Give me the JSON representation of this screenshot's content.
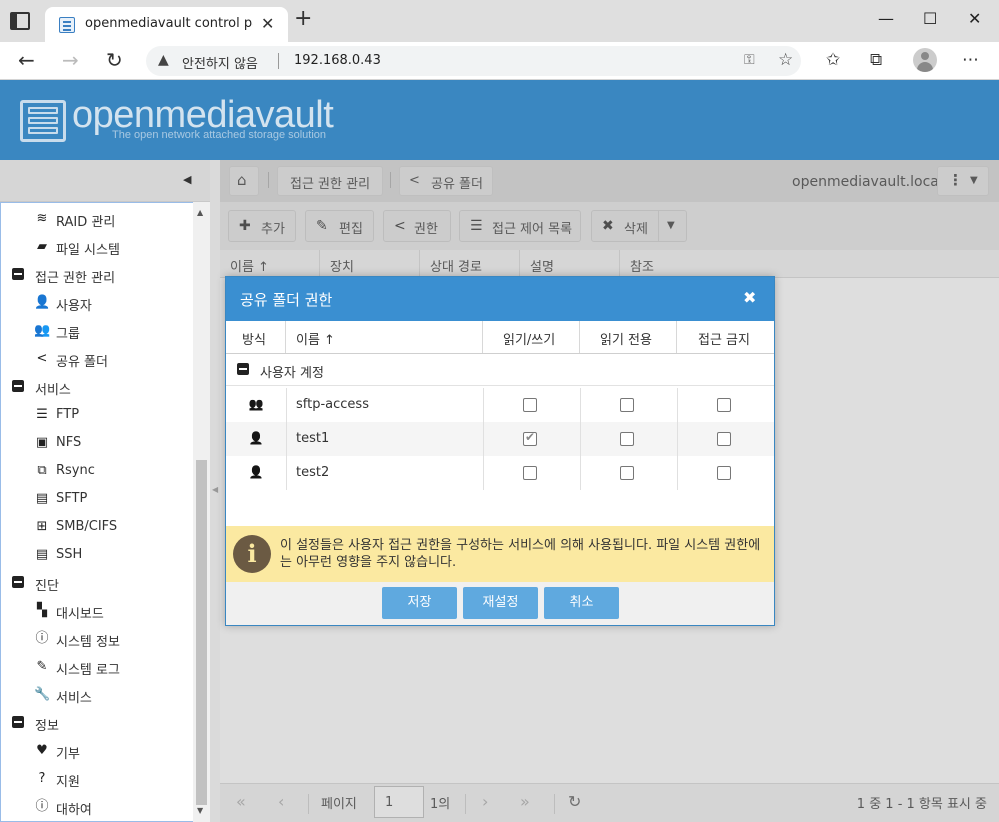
{
  "browser": {
    "tab_title": "openmediavault control panel - c",
    "tab_close": "✕",
    "new_tab": "+",
    "url_insecure": "안전하지 않음",
    "url": "192.168.0.43"
  },
  "omv": {
    "logo_name": "openmediavault",
    "logo_tagline": "The open network attached storage solution",
    "host": "openmediavault.local"
  },
  "nav": {
    "items": [
      {
        "label": "RAID 관리",
        "icon": "raid-icon",
        "glyph": "≋",
        "level": "item"
      },
      {
        "label": "파일 시스템",
        "icon": "folder-icon",
        "glyph": "▰",
        "level": "item"
      },
      {
        "label": "접근 권한 관리",
        "icon": "minus-box-icon",
        "glyph": "",
        "level": "group"
      },
      {
        "label": "사용자",
        "icon": "user-icon",
        "glyph": "👤",
        "level": "item"
      },
      {
        "label": "그룹",
        "icon": "users-icon",
        "glyph": "👥",
        "level": "item"
      },
      {
        "label": "공유 폴더",
        "icon": "share-icon",
        "glyph": "<",
        "level": "item"
      },
      {
        "label": "서비스",
        "icon": "minus-box-icon",
        "glyph": "",
        "level": "group"
      },
      {
        "label": "FTP",
        "icon": "ftp-icon",
        "glyph": "☰",
        "level": "item"
      },
      {
        "label": "NFS",
        "icon": "nfs-icon",
        "glyph": "▣",
        "level": "item"
      },
      {
        "label": "Rsync",
        "icon": "rsync-icon",
        "glyph": "⧉",
        "level": "item"
      },
      {
        "label": "SFTP",
        "icon": "terminal-icon",
        "glyph": "▤",
        "level": "item"
      },
      {
        "label": "SMB/CIFS",
        "icon": "windows-icon",
        "glyph": "⊞",
        "level": "item"
      },
      {
        "label": "SSH",
        "icon": "terminal-icon",
        "glyph": "▤",
        "level": "item"
      },
      {
        "label": "진단",
        "icon": "minus-box-icon",
        "glyph": "",
        "level": "group"
      },
      {
        "label": "대시보드",
        "icon": "dashboard-icon",
        "glyph": "▚",
        "level": "item"
      },
      {
        "label": "시스템 정보",
        "icon": "info-circle-icon",
        "glyph": "ⓘ",
        "level": "item"
      },
      {
        "label": "시스템 로그",
        "icon": "edit-icon",
        "glyph": "✎",
        "level": "item"
      },
      {
        "label": "서비스",
        "icon": "wrench-icon",
        "glyph": "🔧",
        "level": "item"
      },
      {
        "label": "정보",
        "icon": "minus-box-icon",
        "glyph": "",
        "level": "group"
      },
      {
        "label": "기부",
        "icon": "heart-icon",
        "glyph": "♥",
        "level": "item"
      },
      {
        "label": "지원",
        "icon": "question-circle-icon",
        "glyph": "?",
        "level": "item"
      },
      {
        "label": "대하여",
        "icon": "info-circle-icon",
        "glyph": "ⓘ",
        "level": "item"
      }
    ]
  },
  "breadcrumb": {
    "home_icon": "home-icon",
    "section": "접근 권한 관리",
    "page": "공유 폴더"
  },
  "toolbar": {
    "add": "추가",
    "edit": "편집",
    "privileges": "권한",
    "acl": "접근 제어 목록",
    "delete": "삭제"
  },
  "grid": {
    "columns": [
      "이름 ↑",
      "장치",
      "상대 경로",
      "설명",
      "참조"
    ]
  },
  "pager": {
    "page_label": "페이지",
    "page_value": "1",
    "of_label": "1의",
    "status": "1 중 1 - 1 항목 표시 중"
  },
  "dialog": {
    "title": "공유 폴더 권한",
    "columns": {
      "type": "방식",
      "name": "이름 ↑",
      "read_write": "읽기/쓰기",
      "read_only": "읽기 전용",
      "no_access": "접근 금지"
    },
    "group_label": "사용자 계정",
    "rows": [
      {
        "name": "sftp-access",
        "icon": "users-icon",
        "read_write": false,
        "read_only": false,
        "no_access": false
      },
      {
        "name": "test1",
        "icon": "user-icon",
        "read_write": true,
        "read_only": false,
        "no_access": false
      },
      {
        "name": "test2",
        "icon": "user-icon",
        "read_write": false,
        "read_only": false,
        "no_access": false
      }
    ],
    "info": "이 설정들은 사용자 접근 권한을 구성하는 서비스에 의해 사용됩니다. 파일 시스템 권한에는 아무런 영향을 주지 않습니다.",
    "buttons": {
      "save": "저장",
      "reset": "재설정",
      "cancel": "취소"
    }
  },
  "colors": {
    "header_blue": "#3a87c1",
    "dialog_header": "#3a8fd1",
    "button_blue": "#5fa9df",
    "info_yellow": "#fbe9a1"
  }
}
